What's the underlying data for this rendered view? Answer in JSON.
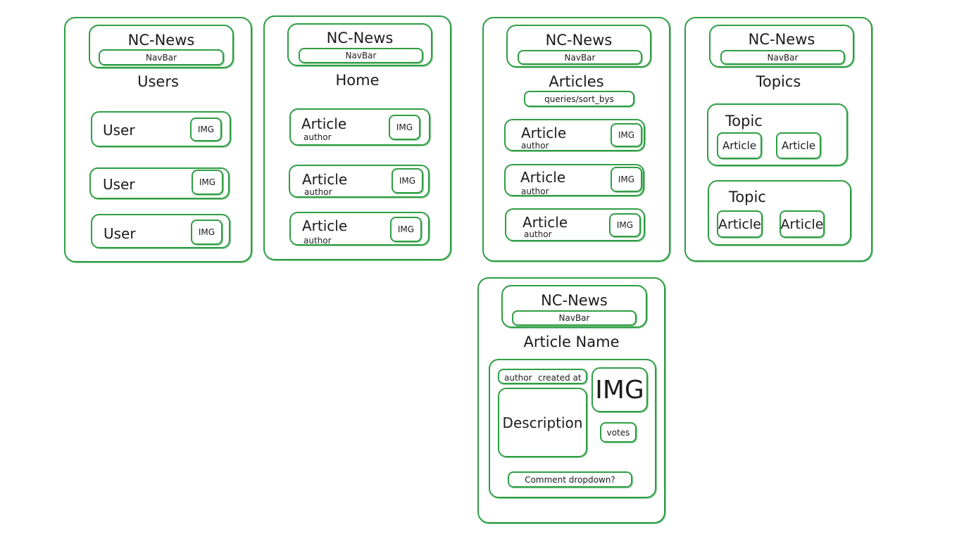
{
  "wireframes": {
    "app_name": "NC-News",
    "nav_label": "NavBar",
    "img_label": "IMG",
    "author_label": "author",
    "users": {
      "title": "Users",
      "rows": [
        "User",
        "User",
        "User"
      ]
    },
    "home": {
      "title": "Home",
      "rows": [
        "Article",
        "Article",
        "Article"
      ]
    },
    "articles": {
      "title": "Articles",
      "queries": "queries/sort_bys",
      "rows": [
        "Article",
        "Article",
        "Article"
      ]
    },
    "topics": {
      "title": "Topics",
      "topic_label": "Topic",
      "article_label": "Article"
    },
    "article_page": {
      "title": "Article Name",
      "author": "author",
      "created_at": "created at",
      "image": "IMG",
      "description": "Description",
      "votes": "votes",
      "comments": "Comment dropdown?"
    }
  },
  "colors": {
    "stroke": "#2f9e44",
    "text": "#1b1b1b",
    "background": "#ffffff"
  }
}
